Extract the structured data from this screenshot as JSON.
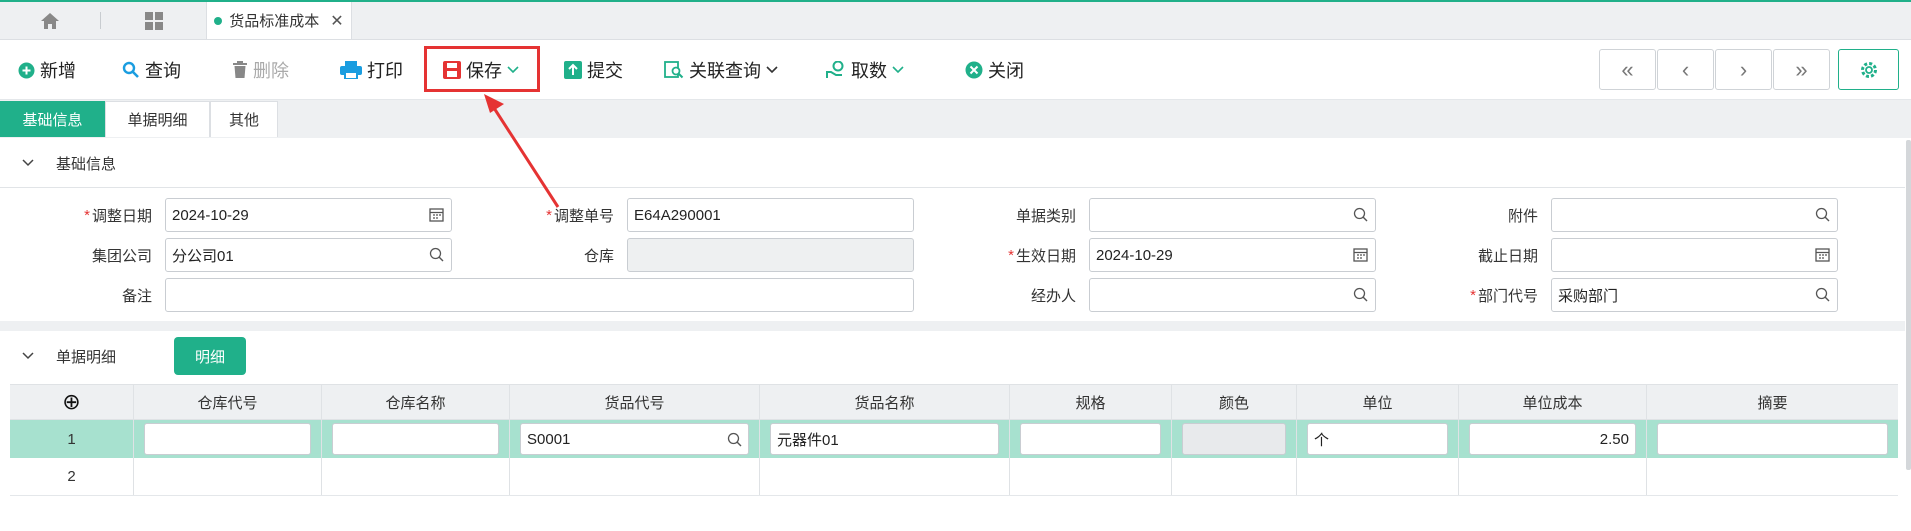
{
  "tabbar": {
    "tab_title": "货品标准成本",
    "close_glyph": "✕"
  },
  "toolbar": {
    "new": "新增",
    "query": "查询",
    "delete": "删除",
    "print": "打印",
    "save": "保存",
    "submit": "提交",
    "related_query": "关联查询",
    "fetch": "取数",
    "close": "关闭"
  },
  "nav": {
    "first": "«",
    "prev": "‹",
    "next": "›",
    "last": "»"
  },
  "subtabs": [
    "基础信息",
    "单据明细",
    "其他"
  ],
  "basic_section": {
    "title": "基础信息"
  },
  "form": {
    "adjust_date_label": "调整日期",
    "adjust_date": "2024-10-29",
    "adjust_no_label": "调整单号",
    "adjust_no": "E64A290001",
    "doc_type_label": "单据类别",
    "doc_type": "",
    "attachment_label": "附件",
    "attachment": "",
    "company_label": "集团公司",
    "company": "分公司01",
    "warehouse_label": "仓库",
    "warehouse": "",
    "effective_date_label": "生效日期",
    "effective_date": "2024-10-29",
    "end_date_label": "截止日期",
    "end_date": "",
    "remark_label": "备注",
    "remark": "",
    "handler_label": "经办人",
    "handler": "",
    "dept_label": "部门代号",
    "dept": "采购部门",
    "required_mark": "*"
  },
  "detail_section": {
    "title": "单据明细",
    "detail_button": "明细"
  },
  "grid": {
    "add_glyph": "⊕",
    "columns": [
      "仓库代号",
      "仓库名称",
      "货品代号",
      "货品名称",
      "规格",
      "颜色",
      "单位",
      "单位成本",
      "摘要"
    ],
    "rows": [
      {
        "no": "1",
        "warehouse_code": "",
        "warehouse_name": "",
        "item_code": "S0001",
        "item_name": "元器件01",
        "spec": "",
        "color": "",
        "unit": "个",
        "unit_cost": "2.50",
        "summary": ""
      },
      {
        "no": "2"
      }
    ]
  },
  "colors": {
    "accent": "#20b08a",
    "highlight_row": "#a7e1cf",
    "annotation": "#e53333"
  }
}
